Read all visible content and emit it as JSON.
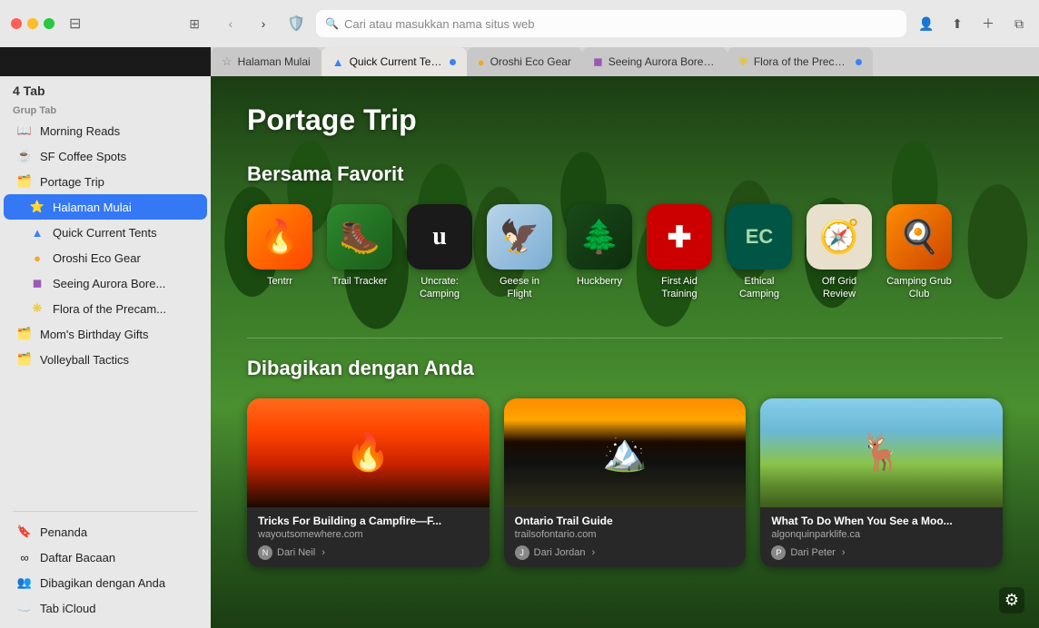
{
  "window": {
    "tab_count": "4 Tab"
  },
  "address_bar": {
    "placeholder": "Cari atau masukkan nama situs web"
  },
  "tabs": [
    {
      "id": "halaman-mulai",
      "label": "Halaman Mulai",
      "favicon_type": "star",
      "active": false,
      "dot": null
    },
    {
      "id": "quick-current-tents",
      "label": "Quick Current Tents",
      "favicon_type": "triangle-blue",
      "active": true,
      "dot": "blue"
    },
    {
      "id": "oroshi-eco-gear",
      "label": "Oroshi Eco Gear",
      "favicon_type": "circle-orange",
      "active": false,
      "dot": null
    },
    {
      "id": "seeing-aurora",
      "label": "Seeing Aurora Boreali...",
      "favicon_type": "square-purple",
      "active": false,
      "dot": null
    },
    {
      "id": "flora-precambi",
      "label": "Flora of the Precambi...",
      "favicon_type": "circle-yellow",
      "active": false,
      "dot": "blue"
    }
  ],
  "sidebar": {
    "tab_count_label": "4 Tab",
    "group_tab_label": "Grup Tab",
    "items": [
      {
        "id": "morning-reads",
        "label": "Morning Reads",
        "icon": "📖",
        "type": "group",
        "active": false
      },
      {
        "id": "sf-coffee-spots",
        "label": "SF Coffee Spots",
        "icon": "☕",
        "type": "group",
        "active": false
      },
      {
        "id": "portage-trip",
        "label": "Portage Trip",
        "icon": "🗺️",
        "type": "group",
        "active": false
      },
      {
        "id": "halaman-mulai",
        "label": "Halaman Mulai",
        "icon": "⭐",
        "type": "tab",
        "active": true
      },
      {
        "id": "quick-current-tents",
        "label": "Quick Current Tents",
        "icon": "🔺",
        "type": "tab",
        "active": false
      },
      {
        "id": "oroshi-eco-gear",
        "label": "Oroshi Eco Gear",
        "icon": "🔴",
        "type": "tab",
        "active": false
      },
      {
        "id": "seeing-aurora",
        "label": "Seeing Aurora Bore...",
        "icon": "🟣",
        "type": "tab",
        "active": false
      },
      {
        "id": "flora-precam",
        "label": "Flora of the Precam...",
        "icon": "🌿",
        "type": "tab",
        "active": false
      },
      {
        "id": "moms-birthday",
        "label": "Mom's Birthday Gifts",
        "icon": "🗂️",
        "type": "group",
        "active": false
      },
      {
        "id": "volleyball-tactics",
        "label": "Volleyball Tactics",
        "icon": "🗂️",
        "type": "group",
        "active": false
      }
    ],
    "bottom_items": [
      {
        "id": "penanda",
        "label": "Penanda",
        "icon": "🔖"
      },
      {
        "id": "daftar-bacaan",
        "label": "Daftar Bacaan",
        "icon": "∞"
      },
      {
        "id": "dibagikan",
        "label": "Dibagikan dengan Anda",
        "icon": "👥"
      },
      {
        "id": "tab-icloud",
        "label": "Tab iCloud",
        "icon": "☁️"
      }
    ]
  },
  "main": {
    "page_title": "Portage Trip",
    "favorites_title": "Bersama Favorit",
    "favorites": [
      {
        "id": "tentrr",
        "label": "Tentrr",
        "bg": "#ff6b1a",
        "icon": "🔥"
      },
      {
        "id": "trail-tracker",
        "label": "Trail Tracker",
        "bg": "#2d8a2d",
        "icon": "🥾"
      },
      {
        "id": "uncrate-camping",
        "label": "Uncrate: Camping",
        "bg": "#1a1a1a",
        "icon": "U"
      },
      {
        "id": "geese-in-flight",
        "label": "Geese in Flight",
        "bg": "#b0cce8",
        "icon": "🪶"
      },
      {
        "id": "huckberry",
        "label": "Huckberry",
        "bg": "#1a4a1a",
        "icon": "🌲"
      },
      {
        "id": "first-aid",
        "label": "First Aid Training",
        "bg": "#cc0000",
        "icon": "➕"
      },
      {
        "id": "ethical-camping",
        "label": "Ethical Camping",
        "bg": "#005544",
        "icon": "EC"
      },
      {
        "id": "off-grid-review",
        "label": "Off Grid Review",
        "bg": "#e8e0cc",
        "icon": "🧭"
      },
      {
        "id": "camping-grub",
        "label": "Camping Grub Club",
        "bg": "#ff6600",
        "icon": "🍳"
      }
    ],
    "shared_title": "Dibagikan dengan Anda",
    "shared_cards": [
      {
        "id": "campfire",
        "title": "Tricks For Building a Campfire—F...",
        "domain": "wayoutsomewhere.com",
        "from": "Dari Neil",
        "img_type": "campfire"
      },
      {
        "id": "ontario-trail",
        "title": "Ontario Trail Guide",
        "domain": "trailsofontario.com",
        "from": "Dari Jordan",
        "img_type": "trail"
      },
      {
        "id": "moose",
        "title": "What To Do When You See a Moo...",
        "domain": "algonquinparklife.ca",
        "from": "Dari Peter",
        "img_type": "moose"
      }
    ]
  }
}
